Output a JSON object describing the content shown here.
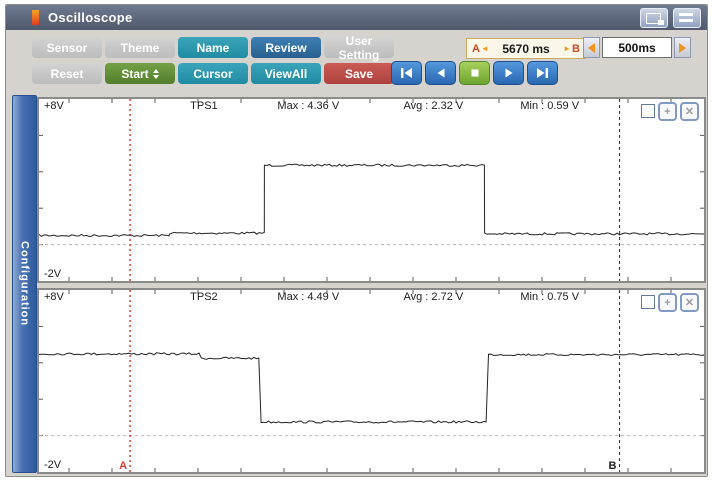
{
  "titlebar": {
    "title": "Oscilloscope"
  },
  "toolbar": {
    "sensor": "Sensor",
    "theme": "Theme",
    "name_btn": "Name",
    "review": "Review",
    "user_setting": "User Setting",
    "reset": "Reset",
    "start": "Start",
    "cursor": "Cursor",
    "view_all": "ViewAll",
    "save": "Save"
  },
  "playback": {
    "buttons": [
      "skip-to-start",
      "step-back",
      "stop",
      "play",
      "skip-to-end"
    ]
  },
  "time_readout": {
    "a": "A",
    "value": "5670 ms",
    "b": "B"
  },
  "interval": {
    "value": "500ms"
  },
  "sidebar": {
    "label": "Configuration"
  },
  "icons": {
    "plus": "+",
    "close": "✕",
    "left_arrow": "◄",
    "right_arrow": "►"
  },
  "colors": {
    "cursor_a": "#e4483c",
    "cursor_b": "#444444",
    "trace": "#222222",
    "zero_line": "#b8b8b8",
    "tick": "#5a5a5a",
    "accent_teal": "#2b96ac",
    "accent_green": "#668f3c",
    "accent_red": "#bb4f4b",
    "accent_blue": "#2f6da8",
    "playback_blue": "#3375bd",
    "stop_green": "#7fb441"
  },
  "chart_data": {
    "type": "line",
    "y_units": "V",
    "y_range": [
      -2,
      8
    ],
    "zero_gridline": 0,
    "cursors": {
      "a": {
        "label": "A",
        "frac": 0.137
      },
      "b": {
        "label": "B",
        "frac": 0.873
      }
    },
    "channels": [
      {
        "name": "TPS1",
        "y_top": "+8V",
        "y_bottom": "-2V",
        "max": "Max : 4.36 V",
        "avg": "Avg : 2.32 V",
        "min": "Min : 0.59 V",
        "max_v": 4.36,
        "avg_v": 2.32,
        "min_v": 0.59,
        "segments": [
          {
            "t0": 0,
            "t1": 0.196,
            "v": 0.5
          },
          {
            "t0": 0.196,
            "t1": 0.339,
            "v": 0.63
          },
          {
            "t0": 0.339,
            "t1": 0.67,
            "v": 4.36
          },
          {
            "t0": 0.67,
            "t1": 1,
            "v": 0.59
          }
        ]
      },
      {
        "name": "TPS2",
        "y_top": "+8V",
        "y_bottom": "-2V",
        "max": "Max : 4.49 V",
        "avg": "Avg : 2.72 V",
        "min": "Min : 0.75 V",
        "max_v": 4.49,
        "avg_v": 2.72,
        "min_v": 0.75,
        "segments": [
          {
            "t0": 0,
            "t1": 0.244,
            "v": 4.49
          },
          {
            "t0": 0.244,
            "t1": 0.334,
            "v": 4.25
          },
          {
            "t0": 0.334,
            "t1": 0.676,
            "v": 0.75
          },
          {
            "t0": 0.676,
            "t1": 1,
            "v": 4.45
          }
        ]
      }
    ]
  }
}
